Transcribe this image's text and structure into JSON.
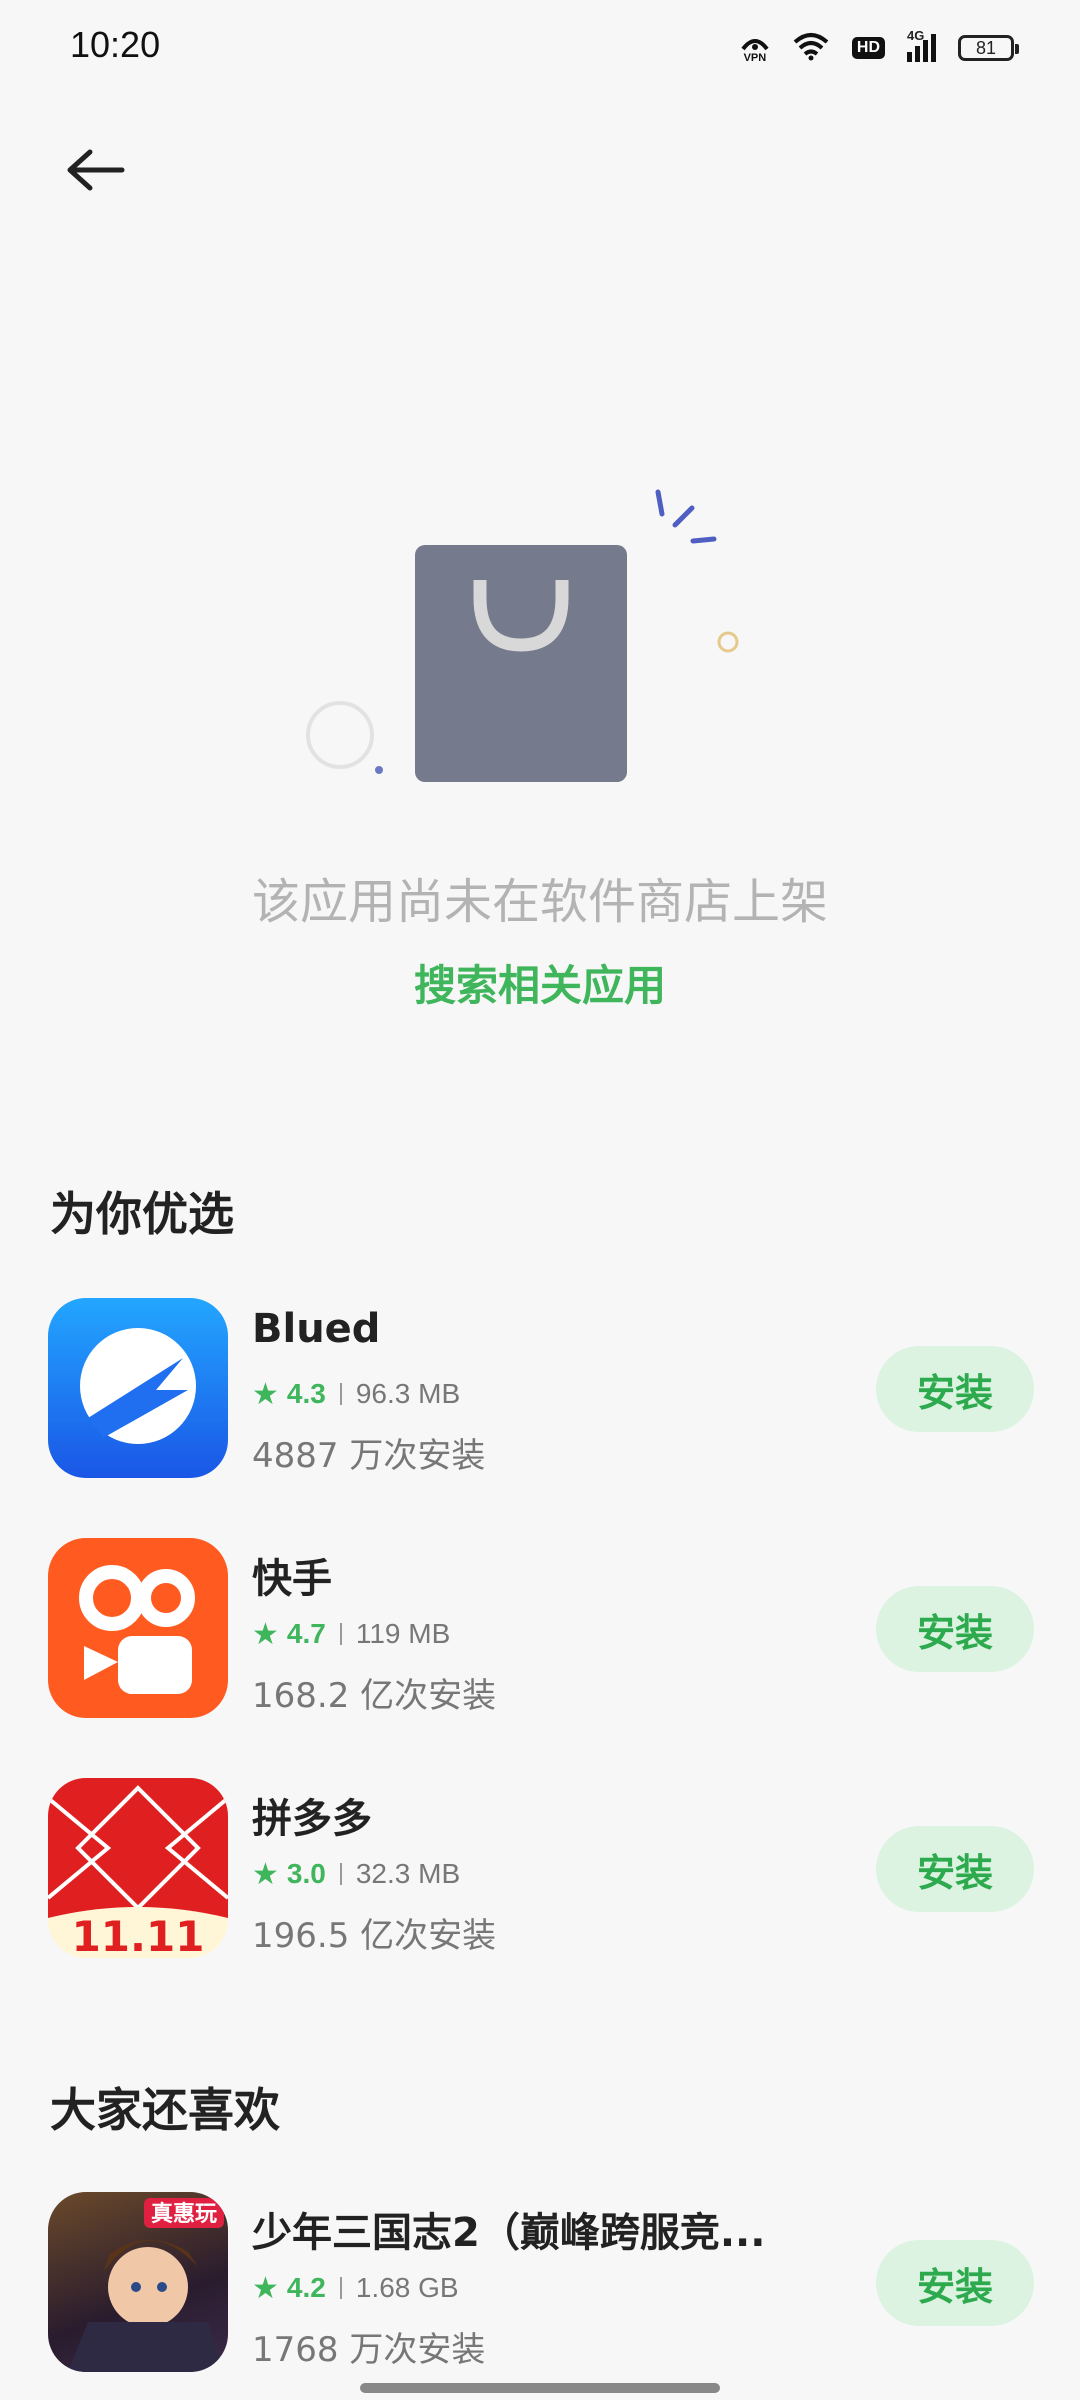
{
  "status_bar": {
    "time": "10:20",
    "vpn_label": "VPN",
    "hd_label": "HD",
    "network_label": "4G",
    "battery_level": "81"
  },
  "empty_state": {
    "message": "该应用尚未在软件商店上架",
    "search_link": "搜索相关应用"
  },
  "sections": [
    {
      "title": "为你优选",
      "apps": [
        {
          "name": "Blued",
          "rating": "4.3",
          "size": "96.3 MB",
          "installs": "4887 万次安装",
          "install_label": "安装",
          "icon": "blued-icon",
          "icon_color": "#1f7bf0"
        },
        {
          "name": "快手",
          "rating": "4.7",
          "size": "119 MB",
          "installs": "168.2 亿次安装",
          "install_label": "安装",
          "icon": "kuaishou-icon",
          "icon_color": "#ff5a1f"
        },
        {
          "name": "拼多多",
          "rating": "3.0",
          "size": "32.3 MB",
          "installs": "196.5 亿次安装",
          "install_label": "安装",
          "icon": "pinduoduo-icon",
          "icon_color": "#e02020"
        }
      ]
    },
    {
      "title": "大家还喜欢",
      "apps": [
        {
          "name": "少年三国志2（巅峰跨服竞...",
          "rating": "4.2",
          "size": "1.68 GB",
          "installs": "1768 万次安装",
          "install_label": "安装",
          "icon": "game-icon",
          "icon_badge": "真惠玩"
        }
      ]
    }
  ],
  "colors": {
    "accent_green": "#3fb55c",
    "install_bg": "#dcf3e2"
  }
}
